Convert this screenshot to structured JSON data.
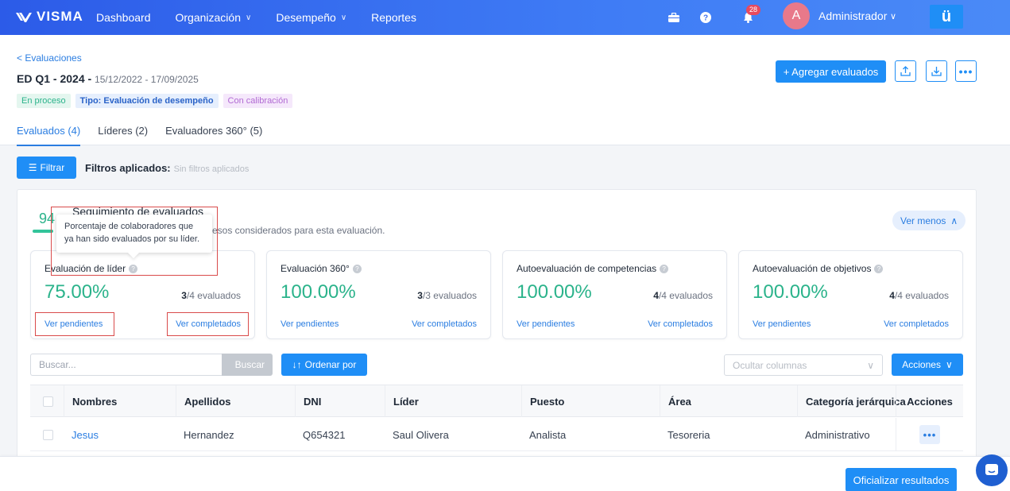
{
  "nav": {
    "logo": "VISMA",
    "items": [
      {
        "label": "Dashboard",
        "dropdown": false
      },
      {
        "label": "Organización",
        "dropdown": true
      },
      {
        "label": "Desempeño",
        "dropdown": true
      },
      {
        "label": "Reportes",
        "dropdown": false
      }
    ],
    "notifications_count": "28",
    "avatar_letter": "A",
    "user_name": "Administrador",
    "app_icon_label": "ü"
  },
  "header": {
    "back_link": "< Evaluaciones",
    "title": "ED Q1 - 2024 - ",
    "dates": "15/12/2022 - 17/09/2025",
    "tags": [
      "En proceso",
      "Tipo: Evaluación de desempeño",
      "Con calibración"
    ],
    "tabs": [
      "Evaluados (4)",
      "Líderes (2)",
      "Evaluadores 360° (5)"
    ],
    "add_button": "+ Agregar evaluados"
  },
  "filters": {
    "button": "Filtrar",
    "label": "Filtros aplicados:",
    "value": "Sin filtros aplicados"
  },
  "tracking": {
    "percent": "94",
    "title": "Seguimiento de evaluados",
    "subtitle": "esos considerados para esta evaluación.",
    "toggle": "Ver menos",
    "tooltip": "Porcentaje de colaboradores que ya han sido evaluados por su líder."
  },
  "stat_cards": [
    {
      "title": "Evaluación de líder",
      "percent": "75.00%",
      "done": "3",
      "total": "/4 evaluados",
      "pending_link": "Ver pendientes",
      "completed_link": "Ver completados"
    },
    {
      "title": "Evaluación 360°",
      "percent": "100.00%",
      "done": "3",
      "total": "/3 evaluados",
      "pending_link": "Ver pendientes",
      "completed_link": "Ver completados"
    },
    {
      "title": "Autoevaluación de competencias",
      "percent": "100.00%",
      "done": "4",
      "total": "/4 evaluados",
      "pending_link": "Ver pendientes",
      "completed_link": "Ver completados"
    },
    {
      "title": "Autoevaluación de objetivos",
      "percent": "100.00%",
      "done": "4",
      "total": "/4 evaluados",
      "pending_link": "Ver pendientes",
      "completed_link": "Ver completados"
    }
  ],
  "search": {
    "placeholder": "Buscar...",
    "button": "Buscar",
    "order_button": "Ordenar por",
    "hide_columns_placeholder": "Ocultar columnas",
    "actions_button": "Acciones"
  },
  "table": {
    "columns": [
      "Nombres",
      "Apellidos",
      "DNI",
      "Líder",
      "Puesto",
      "Área",
      "Categoría jerárquica",
      "Acciones"
    ],
    "rows": [
      {
        "nombres": "Jesus",
        "apellidos": "Hernandez",
        "dni": "Q654321",
        "lider": "Saul Olivera",
        "puesto": "Analista",
        "area": "Tesoreria",
        "categoria": "Administrativo"
      }
    ]
  },
  "footer": {
    "official_button": "Oficializar resultados"
  },
  "colors": {
    "primary": "#1f8ef6",
    "success": "#2bb38b",
    "nav": "#2c5be8",
    "highlight": "#d94b4b"
  }
}
